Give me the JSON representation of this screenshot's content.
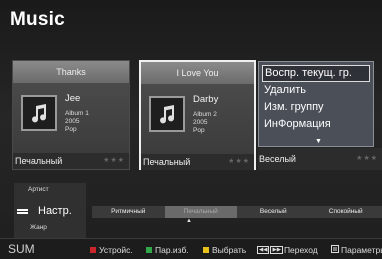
{
  "page_title": "Music",
  "cards": [
    {
      "header": "Thanks",
      "artist": "Jee",
      "album": "Album 1",
      "year": "2005",
      "genre": "Pop",
      "mood": "Печальный",
      "stars": "★★★",
      "selected": false
    },
    {
      "header": "I Love You",
      "artist": "Darby",
      "album": "Album 2",
      "year": "2005",
      "genre": "Pop",
      "mood": "Печальный",
      "stars": "★★★",
      "selected": true
    }
  ],
  "third_card": {
    "mood": "Веселый",
    "stars": "★★★"
  },
  "context_menu": {
    "items": [
      "Воспр. текущ. гр.",
      "Удалить",
      "Изм. группу",
      "ИнФормация"
    ],
    "active_index": 0,
    "more_arrow": "▼"
  },
  "sort": {
    "above": "Артист",
    "current": "Настр.",
    "below": "Жанр",
    "up_arrow": "▲"
  },
  "mood_bar": {
    "items": [
      "Ритмичный",
      "Печальный",
      "Веселый",
      "Спокойный"
    ],
    "active_index": 1,
    "arrow": "▲"
  },
  "bottom_bar": {
    "sum": "SUM",
    "hints": [
      {
        "key": "red",
        "color": "#c8262a",
        "label": "Устройс."
      },
      {
        "key": "green",
        "color": "#32a84a",
        "label": "Пар.изб."
      },
      {
        "key": "yellow",
        "color": "#e6c21a",
        "label": "Выбрать"
      },
      {
        "key": "skip",
        "icon": "skip-icon",
        "label": "Переход"
      },
      {
        "key": "tools",
        "icon": "tools-icon",
        "label": "Параметры"
      }
    ]
  },
  "colors": {
    "selected_border": "#f0f0f0",
    "menu_bg": "#4a4f58"
  },
  "icons": [
    "music-note-icon",
    "sort-list-icon",
    "skip-icon",
    "tools-icon"
  ]
}
